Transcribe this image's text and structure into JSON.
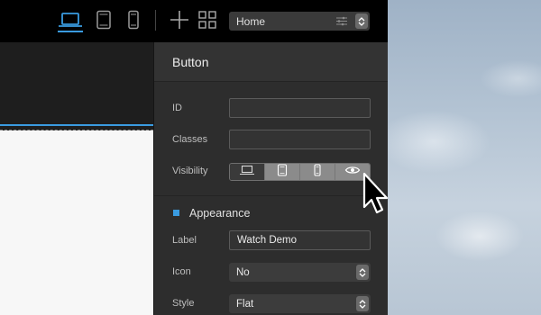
{
  "toolbar": {
    "devices": [
      {
        "name": "laptop",
        "icon": "laptop-icon",
        "active": true
      },
      {
        "name": "tablet",
        "icon": "tablet-icon",
        "active": false
      },
      {
        "name": "phone",
        "icon": "phone-icon",
        "active": false
      }
    ],
    "add_icon": "plus-icon",
    "blocks_icon": "grid-icon",
    "page_select": {
      "value": "Home",
      "icon": "list-settings-icon"
    }
  },
  "inspector": {
    "title": "Button",
    "fields": {
      "id": {
        "label": "ID",
        "value": "",
        "placeholder": ""
      },
      "classes": {
        "label": "Classes",
        "value": "",
        "placeholder": ""
      },
      "visibility": {
        "label": "Visibility",
        "options": [
          {
            "name": "laptop",
            "icon": "laptop-icon",
            "active": true
          },
          {
            "name": "tablet",
            "icon": "tablet-icon",
            "active": false
          },
          {
            "name": "phone",
            "icon": "phone-icon",
            "active": false
          },
          {
            "name": "preview",
            "icon": "eye-icon",
            "active": false
          }
        ]
      }
    },
    "appearance": {
      "title": "Appearance",
      "label": {
        "label": "Label",
        "value": "Watch Demo"
      },
      "icon": {
        "label": "Icon",
        "value": "No"
      },
      "style": {
        "label": "Style",
        "value": "Flat"
      }
    }
  },
  "colors": {
    "accent": "#3a9be0",
    "toolbar_bg": "#000000",
    "panel_bg": "#2d2d2d",
    "canvas_page": "#f7f7f7"
  }
}
